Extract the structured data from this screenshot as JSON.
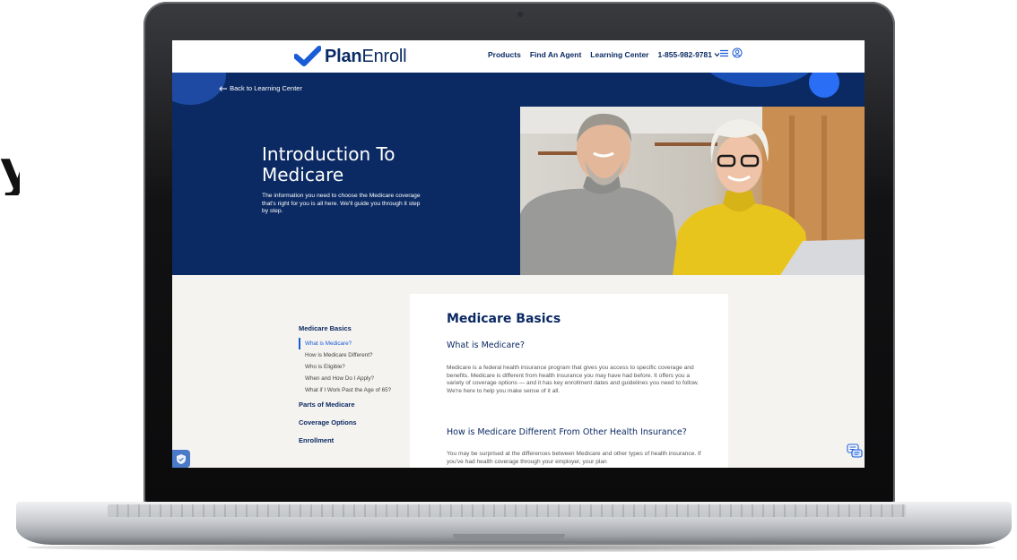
{
  "header": {
    "logo_bold": "Plan",
    "logo_light": "Enroll",
    "nav": [
      "Products",
      "Find An Agent",
      "Learning Center"
    ],
    "phone": "1-855-982-9781"
  },
  "hero": {
    "back_link": "Back to Learning Center",
    "title": "Introduction To Medicare",
    "subtitle": "The information you need to choose the Medicare coverage that's right for you is all here. We'll guide you through it step by step."
  },
  "sidebar": {
    "section1": "Medicare Basics",
    "items": [
      "What is Medicare?",
      "How is Medicare Different?",
      "Who is Eligible?",
      "When and How Do I Apply?",
      "What if I Work Past the Age of 65?"
    ],
    "section2": "Parts of Medicare",
    "section3": "Coverage Options",
    "section4": "Enrollment"
  },
  "article": {
    "heading": "Medicare Basics",
    "sub1": "What is Medicare?",
    "para1": "Medicare is a federal health insurance program that gives you access to specific coverage and benefits. Medicare is different from health insurance you may have had before. It offers you a variety of coverage options — and it has key enrollment dates and guidelines you need to follow. We're here to help you make sense of it all.",
    "sub2": "How is Medicare Different From Other Health Insurance?",
    "para2": "You may be surprised at the differences between Medicare and other types of health insurance. If you've had health coverage through your employer, your plan"
  },
  "edge_letter": "y",
  "colors": {
    "navy": "#0b2a63",
    "accent_blue": "#1a5bd6",
    "content_bg": "#f5f3f0"
  },
  "icons": [
    "check-logo-icon",
    "chevron-down-icon",
    "menu-icon",
    "user-icon",
    "arrow-left-icon",
    "shield-icon",
    "chat-icon"
  ]
}
